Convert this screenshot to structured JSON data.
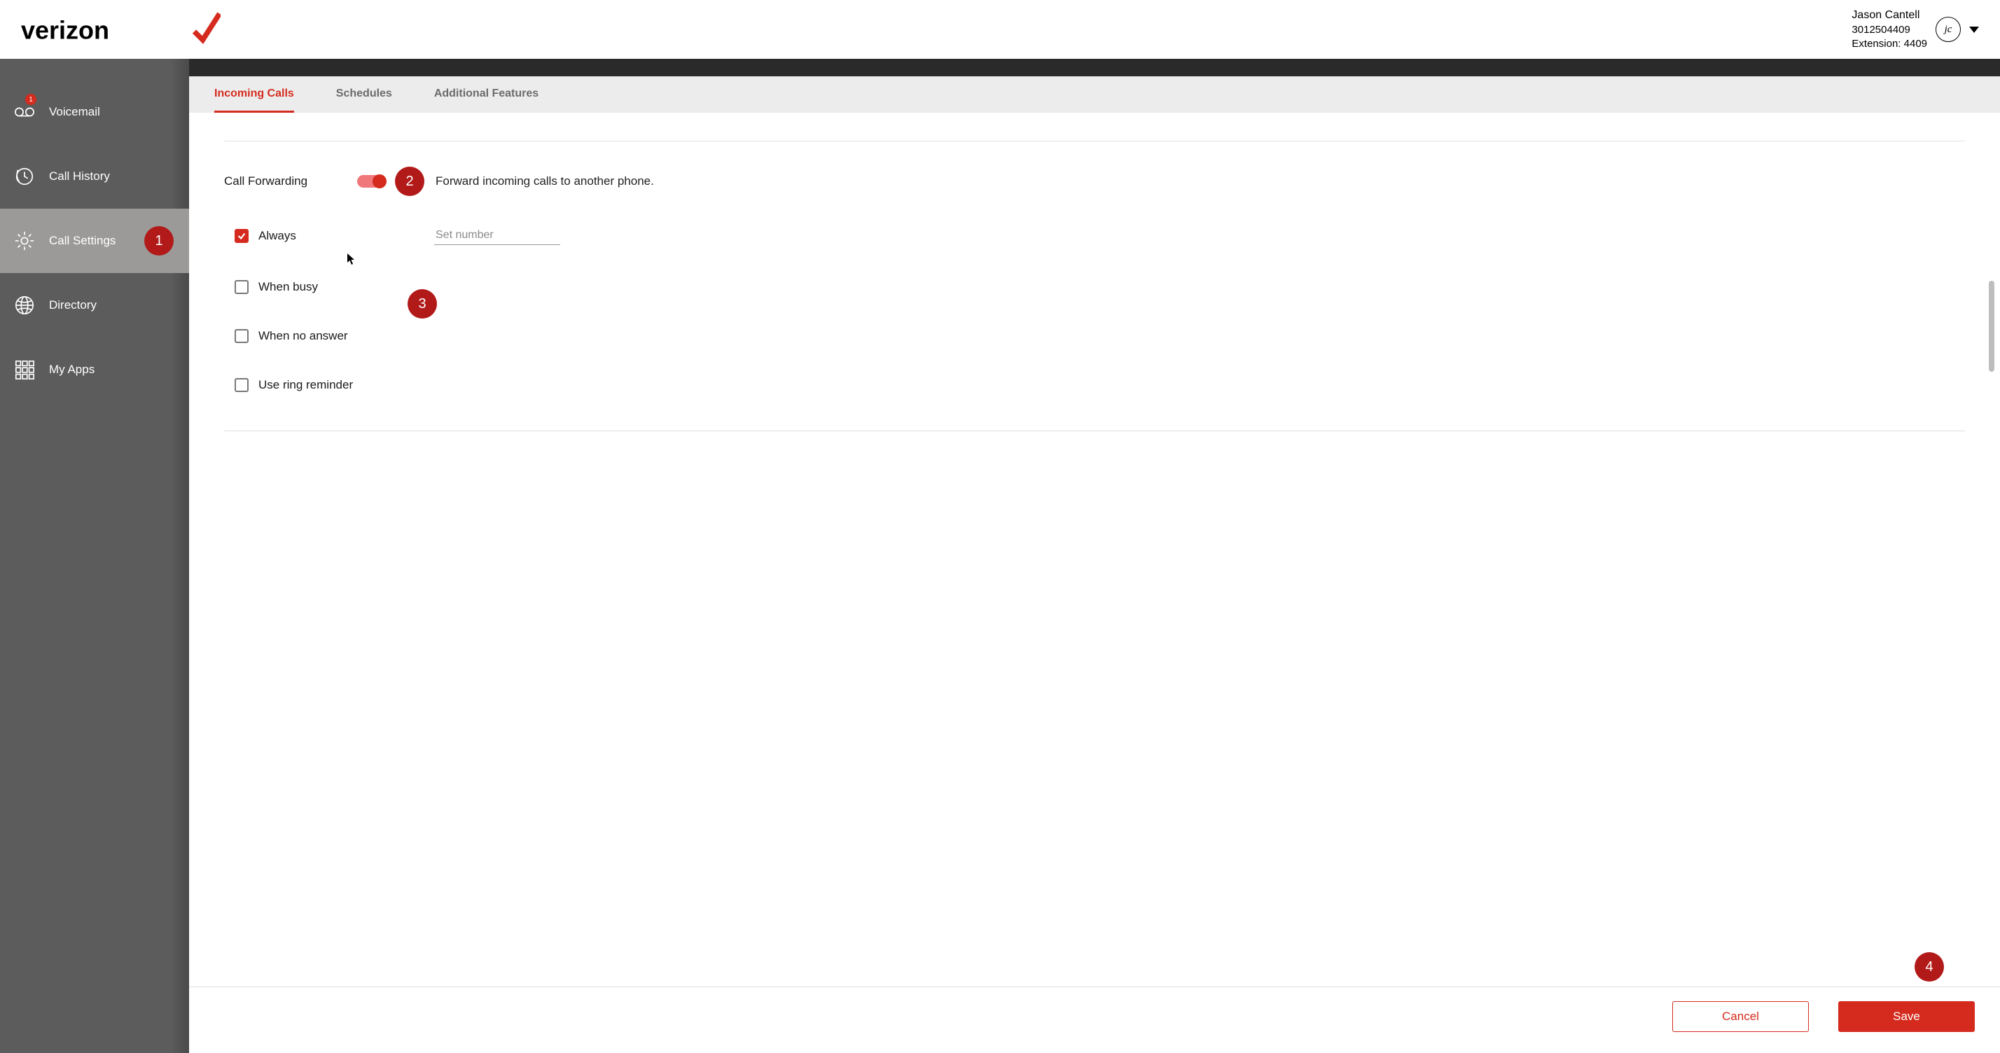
{
  "brand": {
    "name": "verizon"
  },
  "user": {
    "name": "Jason Cantell",
    "phone": "3012504409",
    "extension_label": "Extension: 4409",
    "initials": "jc"
  },
  "sidebar": {
    "items": [
      {
        "label": "Voicemail",
        "badge": "1"
      },
      {
        "label": "Call History"
      },
      {
        "label": "Call Settings"
      },
      {
        "label": "Directory"
      },
      {
        "label": "My Apps"
      }
    ]
  },
  "tabs": [
    {
      "label": "Incoming Calls",
      "active": true
    },
    {
      "label": "Schedules",
      "active": false
    },
    {
      "label": "Additional Features",
      "active": false
    }
  ],
  "call_forwarding": {
    "title": "Call Forwarding",
    "description": "Forward incoming calls to another phone.",
    "enabled": true,
    "set_number_placeholder": "Set number",
    "options": [
      {
        "label": "Always",
        "checked": true,
        "shows_number_field": true
      },
      {
        "label": "When busy",
        "checked": false
      },
      {
        "label": "When no answer",
        "checked": false
      },
      {
        "label": "Use ring reminder",
        "checked": false
      }
    ]
  },
  "footer": {
    "cancel": "Cancel",
    "save": "Save"
  },
  "annotations": [
    {
      "n": "1"
    },
    {
      "n": "2"
    },
    {
      "n": "3"
    },
    {
      "n": "4"
    }
  ]
}
